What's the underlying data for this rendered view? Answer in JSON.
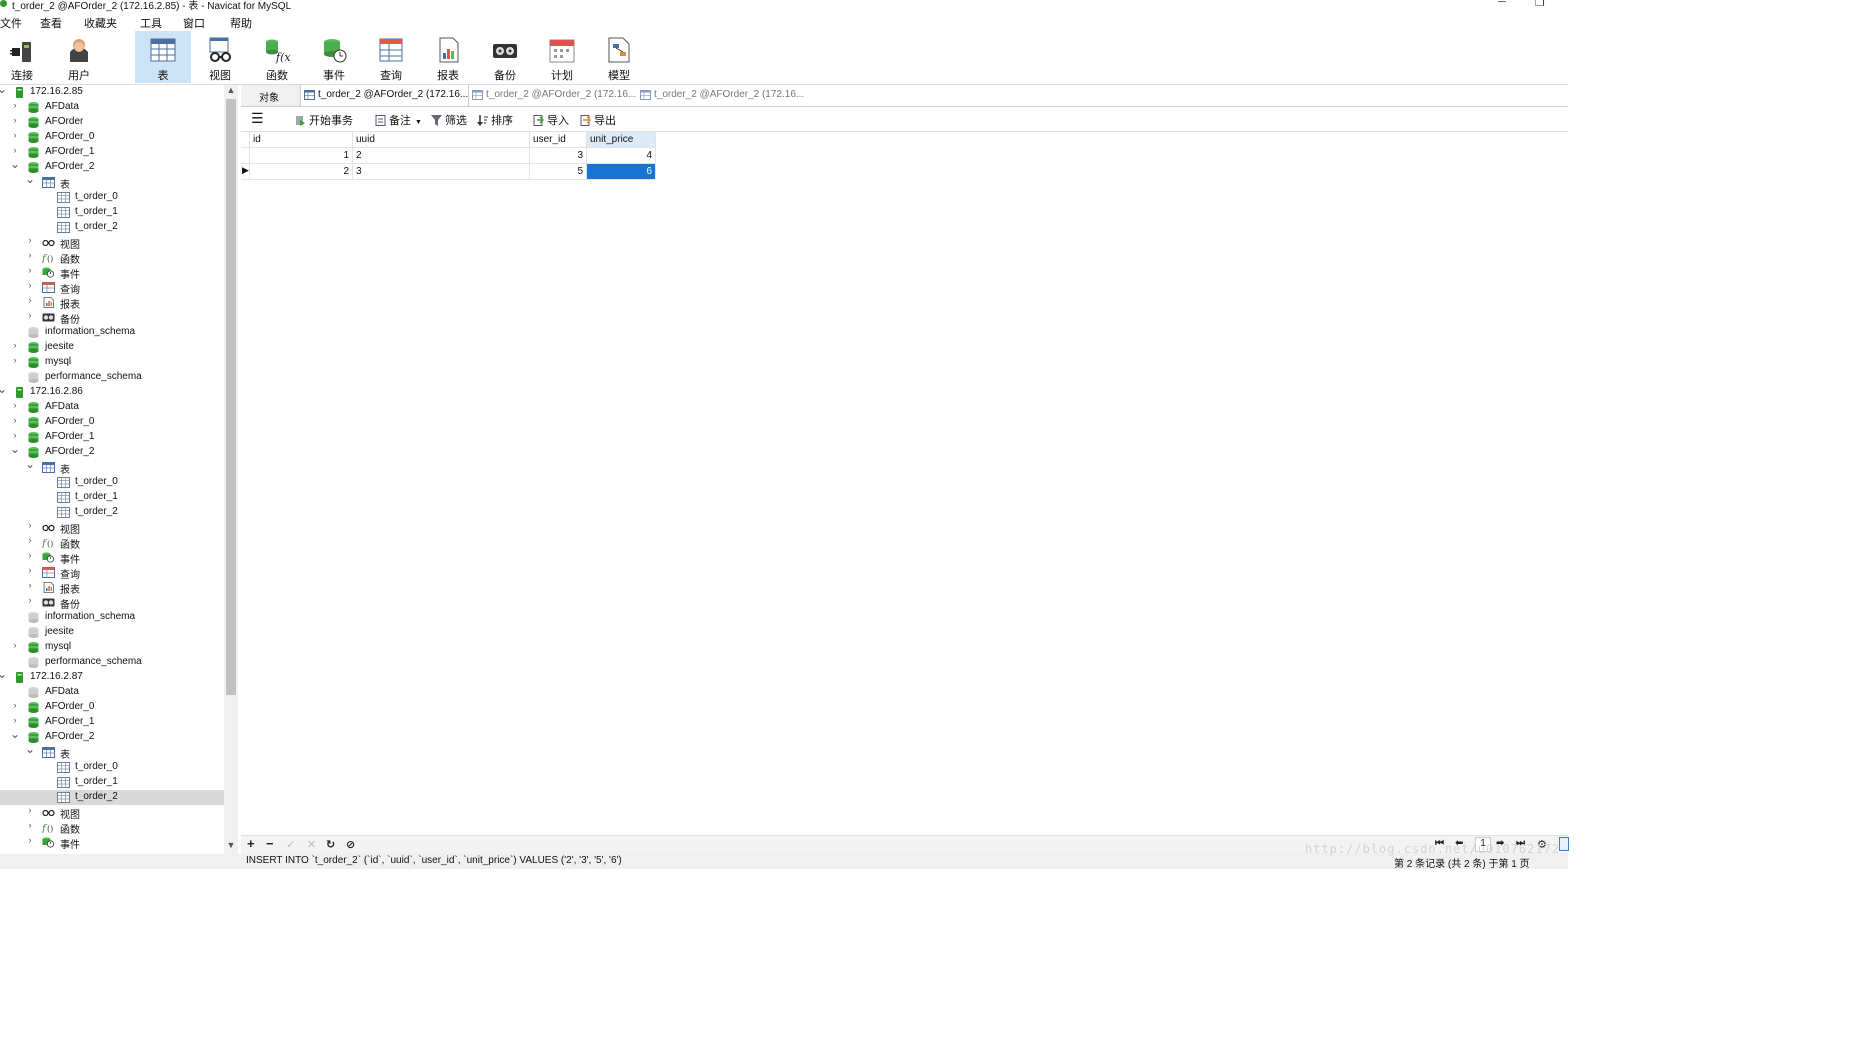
{
  "window": {
    "title": "t_order_2 @AFOrder_2 (172.16.2.85) - 表 - Navicat for MySQL"
  },
  "menu": [
    "文件",
    "查看",
    "收藏夹",
    "工具",
    "窗口",
    "帮助"
  ],
  "toolbar": [
    {
      "label": "连接",
      "icon": "plug-icon"
    },
    {
      "label": "用户",
      "icon": "user-icon"
    },
    {
      "label": "表",
      "icon": "table-icon",
      "active": true
    },
    {
      "label": "视图",
      "icon": "glasses-icon"
    },
    {
      "label": "函数",
      "icon": "function-icon"
    },
    {
      "label": "事件",
      "icon": "event-clock-icon"
    },
    {
      "label": "查询",
      "icon": "query-icon"
    },
    {
      "label": "报表",
      "icon": "report-icon"
    },
    {
      "label": "备份",
      "icon": "backup-icon"
    },
    {
      "label": "计划",
      "icon": "calendar-icon"
    },
    {
      "label": "模型",
      "icon": "model-icon"
    }
  ],
  "tree": {
    "rows": [
      {
        "label": "172.16.2.85",
        "type": "server",
        "level": 0,
        "exp": "open"
      },
      {
        "label": "AFData",
        "type": "db",
        "level": 1,
        "exp": "closed"
      },
      {
        "label": "AFOrder",
        "type": "db",
        "level": 1,
        "exp": "closed"
      },
      {
        "label": "AFOrder_0",
        "type": "db",
        "level": 1,
        "exp": "closed"
      },
      {
        "label": "AFOrder_1",
        "type": "db",
        "level": 1,
        "exp": "closed"
      },
      {
        "label": "AFOrder_2",
        "type": "db",
        "level": 1,
        "exp": "open"
      },
      {
        "label": "表",
        "type": "tables",
        "level": 2,
        "exp": "open"
      },
      {
        "label": "t_order_0",
        "type": "table",
        "level": 3,
        "exp": "none"
      },
      {
        "label": "t_order_1",
        "type": "table",
        "level": 3,
        "exp": "none"
      },
      {
        "label": "t_order_2",
        "type": "table",
        "level": 3,
        "exp": "none"
      },
      {
        "label": "视图",
        "type": "view",
        "level": 2,
        "exp": "closed"
      },
      {
        "label": "函数",
        "type": "func",
        "level": 2,
        "exp": "closed"
      },
      {
        "label": "事件",
        "type": "event",
        "level": 2,
        "exp": "closed"
      },
      {
        "label": "查询",
        "type": "query",
        "level": 2,
        "exp": "closed"
      },
      {
        "label": "报表",
        "type": "report",
        "level": 2,
        "exp": "closed"
      },
      {
        "label": "备份",
        "type": "backup",
        "level": 2,
        "exp": "closed"
      },
      {
        "label": "information_schema",
        "type": "dbgray",
        "level": 1,
        "exp": "none"
      },
      {
        "label": "jeesite",
        "type": "db",
        "level": 1,
        "exp": "closed"
      },
      {
        "label": "mysql",
        "type": "db",
        "level": 1,
        "exp": "closed"
      },
      {
        "label": "performance_schema",
        "type": "dbgray",
        "level": 1,
        "exp": "none"
      },
      {
        "label": "172.16.2.86",
        "type": "server",
        "level": 0,
        "exp": "open"
      },
      {
        "label": "AFData",
        "type": "db",
        "level": 1,
        "exp": "closed"
      },
      {
        "label": "AFOrder_0",
        "type": "db",
        "level": 1,
        "exp": "closed"
      },
      {
        "label": "AFOrder_1",
        "type": "db",
        "level": 1,
        "exp": "closed"
      },
      {
        "label": "AFOrder_2",
        "type": "db",
        "level": 1,
        "exp": "open"
      },
      {
        "label": "表",
        "type": "tables",
        "level": 2,
        "exp": "open"
      },
      {
        "label": "t_order_0",
        "type": "table",
        "level": 3,
        "exp": "none"
      },
      {
        "label": "t_order_1",
        "type": "table",
        "level": 3,
        "exp": "none"
      },
      {
        "label": "t_order_2",
        "type": "table",
        "level": 3,
        "exp": "none"
      },
      {
        "label": "视图",
        "type": "view",
        "level": 2,
        "exp": "closed"
      },
      {
        "label": "函数",
        "type": "func",
        "level": 2,
        "exp": "closed"
      },
      {
        "label": "事件",
        "type": "event",
        "level": 2,
        "exp": "closed"
      },
      {
        "label": "查询",
        "type": "query",
        "level": 2,
        "exp": "closed"
      },
      {
        "label": "报表",
        "type": "report",
        "level": 2,
        "exp": "closed"
      },
      {
        "label": "备份",
        "type": "backup",
        "level": 2,
        "exp": "closed"
      },
      {
        "label": "information_schema",
        "type": "dbgray",
        "level": 1,
        "exp": "none"
      },
      {
        "label": "jeesite",
        "type": "dbgray",
        "level": 1,
        "exp": "none"
      },
      {
        "label": "mysql",
        "type": "db",
        "level": 1,
        "exp": "closed"
      },
      {
        "label": "performance_schema",
        "type": "dbgray",
        "level": 1,
        "exp": "none"
      },
      {
        "label": "172.16.2.87",
        "type": "server",
        "level": 0,
        "exp": "open"
      },
      {
        "label": "AFData",
        "type": "dbgray",
        "level": 1,
        "exp": "none"
      },
      {
        "label": "AFOrder_0",
        "type": "db",
        "level": 1,
        "exp": "closed"
      },
      {
        "label": "AFOrder_1",
        "type": "db",
        "level": 1,
        "exp": "closed"
      },
      {
        "label": "AFOrder_2",
        "type": "db",
        "level": 1,
        "exp": "open"
      },
      {
        "label": "表",
        "type": "tables",
        "level": 2,
        "exp": "open"
      },
      {
        "label": "t_order_0",
        "type": "table",
        "level": 3,
        "exp": "none"
      },
      {
        "label": "t_order_1",
        "type": "table",
        "level": 3,
        "exp": "none"
      },
      {
        "label": "t_order_2",
        "type": "table",
        "level": 3,
        "exp": "none",
        "selected": true
      },
      {
        "label": "视图",
        "type": "view",
        "level": 2,
        "exp": "closed"
      },
      {
        "label": "函数",
        "type": "func",
        "level": 2,
        "exp": "closed"
      },
      {
        "label": "事件",
        "type": "event",
        "level": 2,
        "exp": "closed"
      }
    ]
  },
  "tabs": [
    {
      "label": "对象",
      "icon": "none"
    },
    {
      "label": "t_order_2 @AFOrder_2 (172.16....",
      "icon": "table-icon",
      "active": true
    },
    {
      "label": "t_order_2 @AFOrder_2 (172.16....",
      "icon": "table-icon"
    },
    {
      "label": "t_order_2 @AFOrder_2 (172.16....",
      "icon": "table-icon"
    }
  ],
  "table_toolbar": {
    "menu_icon": "hamburger-icon",
    "begin_tx": "开始事务",
    "memo": "备注",
    "filter": "筛选",
    "sort": "排序",
    "import": "导入",
    "export": "导出"
  },
  "grid": {
    "columns": [
      "id",
      "uuid",
      "user_id",
      "unit_price"
    ],
    "rows": [
      [
        "1",
        "2",
        "3",
        "4"
      ],
      [
        "2",
        "3",
        "5",
        "6"
      ]
    ],
    "current_row": 1,
    "selected_cell": {
      "row": 1,
      "col": 3
    }
  },
  "bottombar": {
    "add": "+",
    "remove": "−",
    "apply": "✓",
    "discard": "✕",
    "refresh": "↻",
    "stop": "⊘",
    "first": "⏮",
    "prev": "⬅",
    "page": "1",
    "next": "➡",
    "last": "⏭",
    "settings": "⚙"
  },
  "status": {
    "sql": "INSERT INTO `t_order_2` (`id`, `uuid`, `user_id`, `unit_price`) VALUES ('2', '3', '5', '6')",
    "record": "第 2 条记录 (共 2 条) 于第 1 页"
  },
  "watermark": "http://blog.csdn.net/u010762172"
}
